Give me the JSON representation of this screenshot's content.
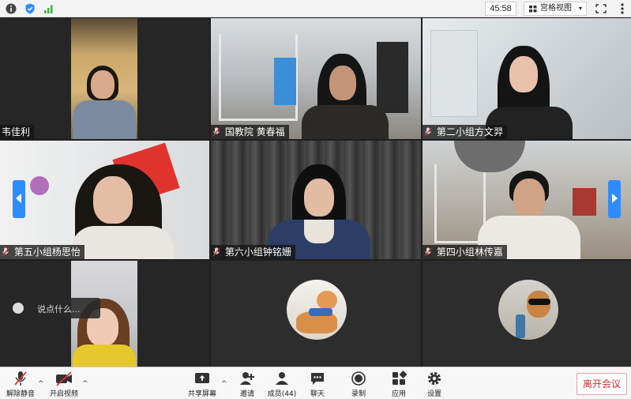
{
  "topbar": {
    "timer": "45:58",
    "view_label": "宫格视图",
    "view_caret": "▾"
  },
  "participants": [
    {
      "name": "韦佳利"
    },
    {
      "name": "国教院 黄春福"
    },
    {
      "name": "第二小组方文羿"
    },
    {
      "name": "第五小组杨思怡"
    },
    {
      "name": "第六小组钟铭姗"
    },
    {
      "name": "第四小组林传嘉"
    }
  ],
  "chat": {
    "placeholder": "说点什么..."
  },
  "toolbar": {
    "unmute": "解除静音",
    "start_video": "开启视频",
    "share_screen": "共享屏幕",
    "invite": "邀请",
    "members": "成员(44)",
    "chat": "聊天",
    "record": "录制",
    "apps": "应用",
    "settings": "设置",
    "leave": "离开会议",
    "caret": "^"
  },
  "colors": {
    "accent": "#2e8cff",
    "leave_red": "#e02b2b",
    "mic_muted": "#e03030"
  }
}
